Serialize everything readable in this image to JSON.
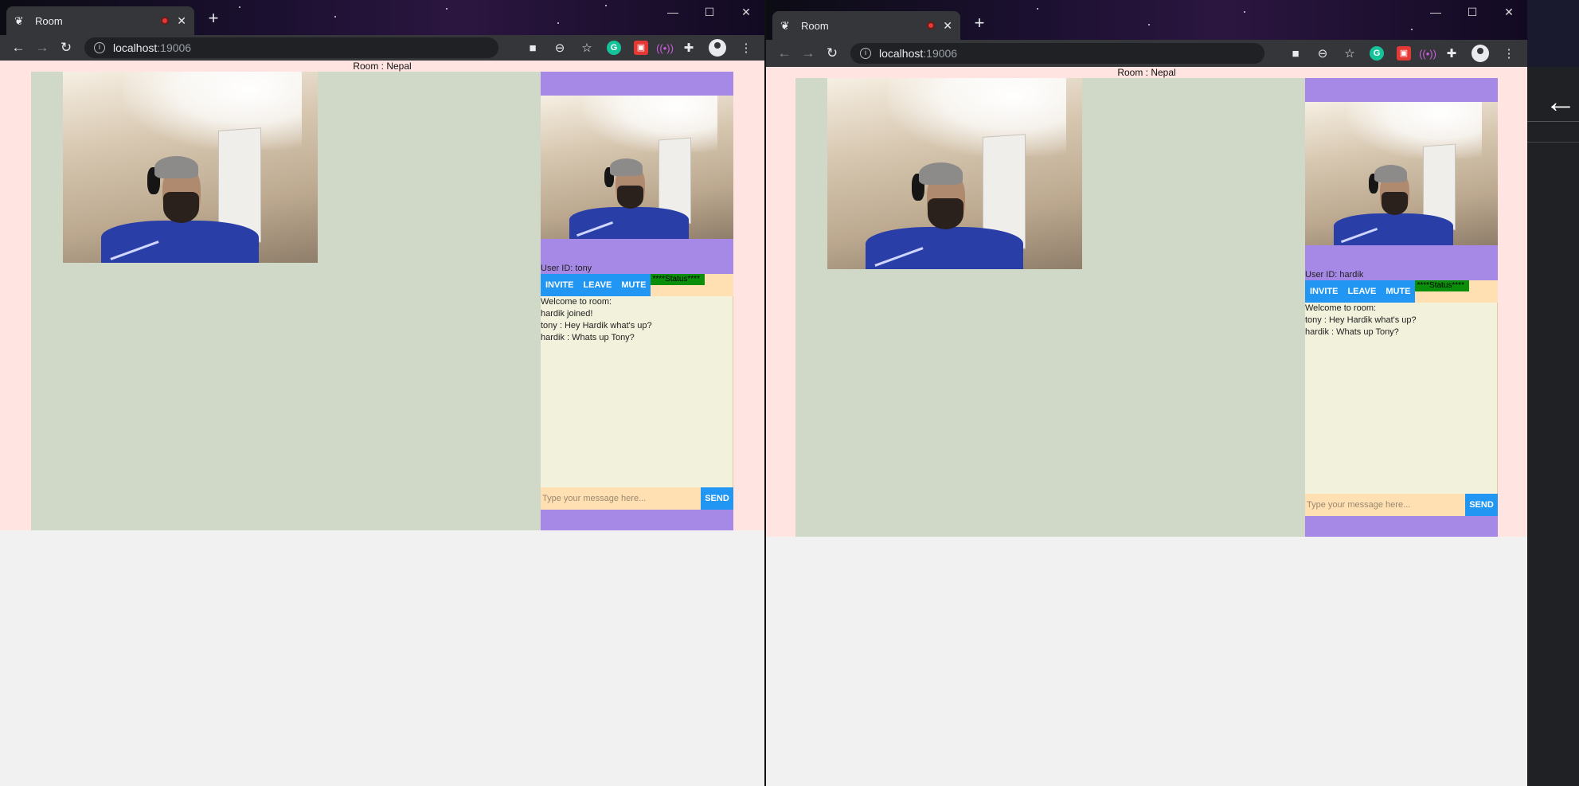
{
  "windows": [
    {
      "tab_title": "Room",
      "url_host": "localhost",
      "url_port": ":19006",
      "room_title": "Room : Nepal",
      "user_id": "User ID: tony",
      "buttons": {
        "invite": "INVITE",
        "leave": "LEAVE",
        "mute": "MUTE",
        "send": "SEND"
      },
      "status": "****Status****",
      "messages": [
        "Welcome to room:",
        "hardik joined!",
        "tony : Hey Hardik what's up?",
        "hardik : Whats up Tony?"
      ],
      "message_placeholder": "Type your message here..."
    },
    {
      "tab_title": "Room",
      "url_host": "localhost",
      "url_port": ":19006",
      "room_title": "Room : Nepal",
      "user_id": "User ID: hardik",
      "buttons": {
        "invite": "INVITE",
        "leave": "LEAVE",
        "mute": "MUTE",
        "send": "SEND"
      },
      "status": "****Status****",
      "messages": [
        "Welcome to room:",
        "tony : Hey Hardik what's up?",
        "hardik : Whats up Tony?"
      ],
      "message_placeholder": "Type your message here..."
    }
  ],
  "icons": {
    "back": "arrow-left-icon",
    "forward": "arrow-right-icon",
    "reload": "reload-icon",
    "camera": "camera-icon",
    "zoom": "zoom-icon",
    "bookmark": "star-icon",
    "grammarly": "grammarly-icon",
    "extension": "puzzle-icon",
    "profile": "profile-icon",
    "menu": "kebab-menu-icon"
  },
  "colors": {
    "page_bg": "#ffe4e1",
    "stage_bg": "#d0d9c7",
    "sidebar_bg": "#a688e6",
    "controls_bg": "#ffe0b2",
    "button_bg": "#2196f3",
    "status_bg": "#0b8f0b",
    "chat_bg": "#f1f1dc"
  }
}
